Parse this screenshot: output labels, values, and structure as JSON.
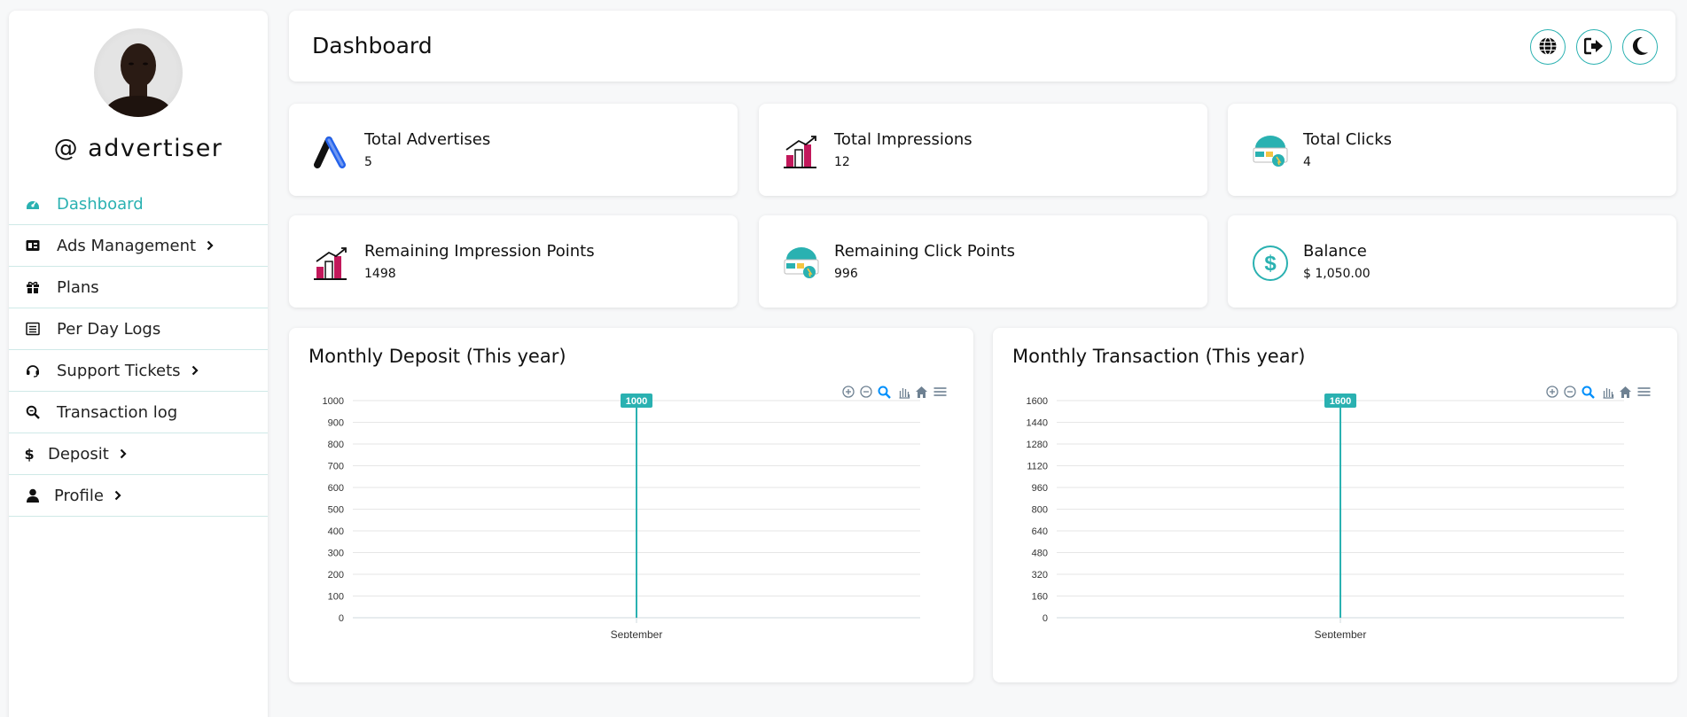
{
  "sidebar": {
    "username": "@ advertiser",
    "items": [
      {
        "label": "Dashboard",
        "icon": "gauge-icon",
        "active": true,
        "has_chevron": false
      },
      {
        "label": "Ads Management",
        "icon": "ad-icon",
        "active": false,
        "has_chevron": true
      },
      {
        "label": "Plans",
        "icon": "gift-icon",
        "active": false,
        "has_chevron": false
      },
      {
        "label": "Per Day Logs",
        "icon": "list-icon",
        "active": false,
        "has_chevron": false
      },
      {
        "label": "Support Tickets",
        "icon": "headset-icon",
        "active": false,
        "has_chevron": true
      },
      {
        "label": "Transaction log",
        "icon": "search-icon",
        "active": false,
        "has_chevron": false
      },
      {
        "label": "Deposit",
        "icon": "dollar-icon",
        "active": false,
        "has_chevron": true
      },
      {
        "label": "Profile",
        "icon": "user-icon",
        "active": false,
        "has_chevron": true
      }
    ]
  },
  "header": {
    "title": "Dashboard",
    "buttons": [
      "globe-icon",
      "logout-icon",
      "moon-icon"
    ]
  },
  "stats": [
    {
      "label": "Total Advertises",
      "value": "5",
      "icon": "google-ads-icon"
    },
    {
      "label": "Total Impressions",
      "value": "12",
      "icon": "bar-chart-icon"
    },
    {
      "label": "Total Clicks",
      "value": "4",
      "icon": "click-icon"
    },
    {
      "label": "Remaining Impression Points",
      "value": "1498",
      "icon": "bar-chart-icon"
    },
    {
      "label": "Remaining Click Points",
      "value": "996",
      "icon": "click-icon"
    },
    {
      "label": "Balance",
      "value": "$ 1,050.00",
      "icon": "dollar-circle-icon"
    }
  ],
  "colors": {
    "accent": "#2ab1b1",
    "grid": "#e6e6e6",
    "axis_text": "#333333"
  },
  "chart_data": [
    {
      "type": "bar",
      "title": "Monthly Deposit (This year)",
      "categories": [
        "September"
      ],
      "series": [
        {
          "values": [
            1000
          ]
        }
      ],
      "ylim": [
        0,
        1000
      ],
      "yticks": [
        "1000",
        "900",
        "800",
        "700",
        "600",
        "500",
        "400",
        "300",
        "200",
        "100",
        "0"
      ],
      "data_labels": [
        "1000"
      ],
      "grid": true,
      "toolbar": [
        "zoom-in-icon",
        "zoom-out-icon",
        "magnifier-icon",
        "pan-hand-icon",
        "home-icon",
        "menu-icon"
      ]
    },
    {
      "type": "bar",
      "title": "Monthly Transaction (This year)",
      "categories": [
        "September"
      ],
      "series": [
        {
          "values": [
            1600
          ]
        }
      ],
      "ylim": [
        0,
        1600
      ],
      "yticks": [
        "1600",
        "1440",
        "1280",
        "1120",
        "960",
        "800",
        "640",
        "480",
        "320",
        "160",
        "0"
      ],
      "data_labels": [
        "1600"
      ],
      "grid": true,
      "toolbar": [
        "zoom-in-icon",
        "zoom-out-icon",
        "magnifier-icon",
        "pan-hand-icon",
        "home-icon",
        "menu-icon"
      ]
    }
  ]
}
